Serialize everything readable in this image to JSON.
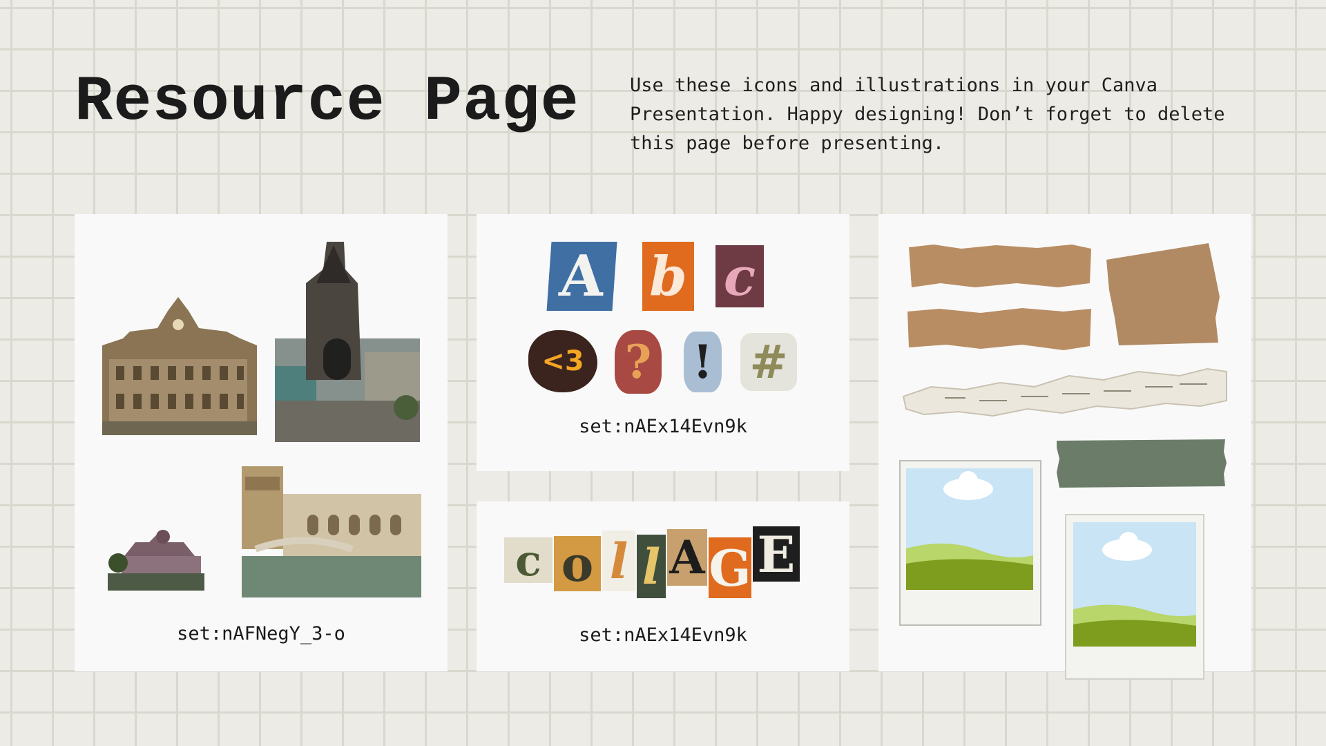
{
  "page": {
    "title": "Resource Page",
    "description": "Use these icons and illustrations in your Canva Presentation. Happy designing! Don’t forget to delete this page before presenting."
  },
  "cards": {
    "buildings": {
      "caption": "set:nAFNegY_3-o"
    },
    "alphabet": {
      "caption": "set:nAEx14Evn9k",
      "letters": [
        "A",
        "b",
        "c"
      ],
      "symbols": [
        "<3",
        "?",
        "!",
        "#"
      ]
    },
    "collage": {
      "caption": "set:nAEx14Evn9k",
      "letters": [
        "c",
        "o",
        "l",
        "l",
        "A",
        "G",
        "E"
      ]
    },
    "paper": {}
  },
  "colors": {
    "background": "#ecebe5",
    "grid": "#d9d8cf",
    "card": "#f9f9f9",
    "kraft": "#b98d63",
    "tape_green": "#6b7d69",
    "sky": "#c9e4f5",
    "grass": "#7e9c1d"
  }
}
